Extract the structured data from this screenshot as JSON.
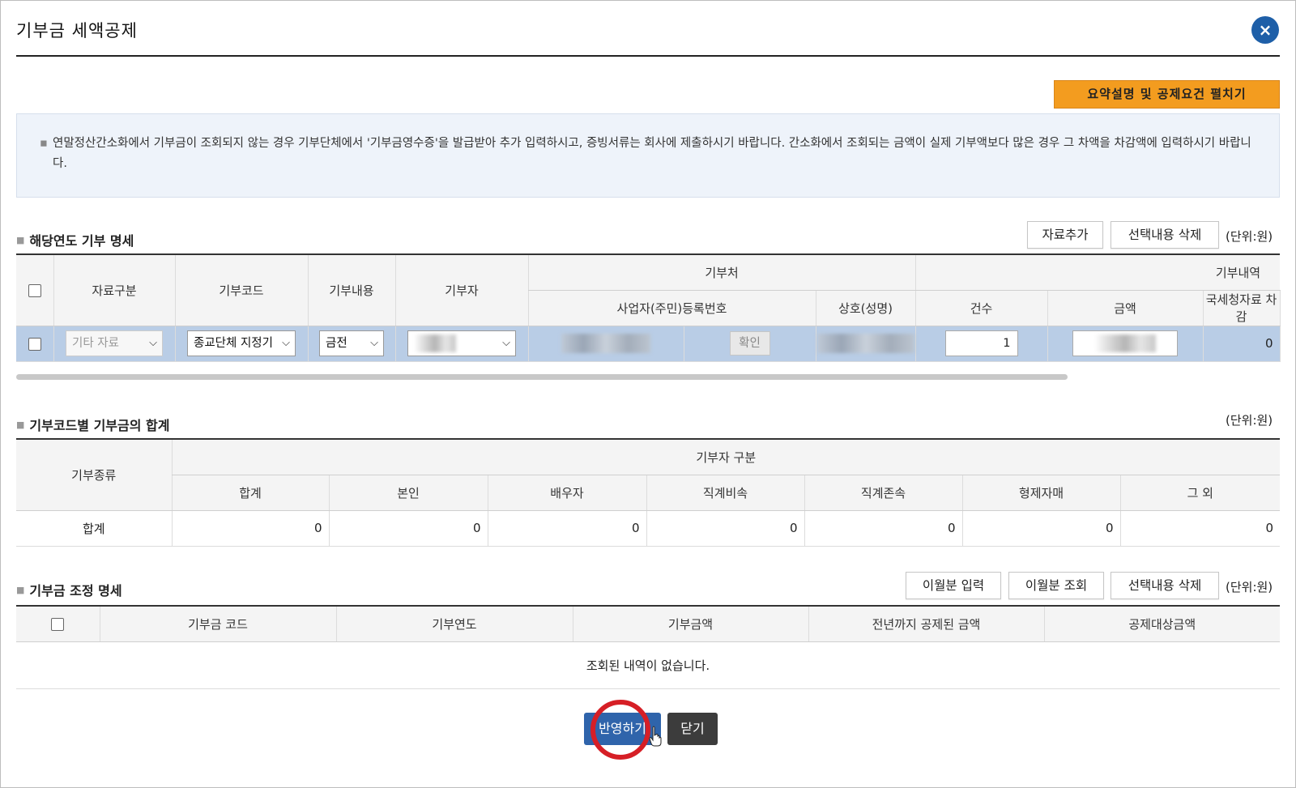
{
  "dialog": {
    "title": "기부금 세액공제",
    "close_label": "×",
    "summary_button": "요약설명 및 공제요건 펼치기",
    "notice": "연말정산간소화에서 기부금이 조회되지 않는 경우 기부단체에서 '기부금영수증'을 발급받아 추가 입력하시고, 증빙서류는 회사에 제출하시기 바랍니다. 간소화에서 조회되는 금액이 실제 기부액보다 많은 경우 그 차액을 차감액에 입력하시기 바랍니다."
  },
  "section1": {
    "title": "해당연도 기부 명세",
    "add_button": "자료추가",
    "delete_button": "선택내용 삭제",
    "unit": "(단위:원)",
    "headers": {
      "data_type": "자료구분",
      "code": "기부코드",
      "content": "기부내용",
      "donor": "기부자",
      "recipient_group": "기부처",
      "reg_no": "사업자(주민)등록번호",
      "name": "상호(성명)",
      "detail_group": "기부내역",
      "count": "건수",
      "amount": "금액",
      "nts_deduct": "국세청자료 차감"
    },
    "row": {
      "data_type": "기타 자료",
      "code": "종교단체 지정기",
      "content": "금전",
      "confirm": "확인",
      "count": "1",
      "nts_deduct": "0"
    }
  },
  "section2": {
    "title": "기부코드별 기부금의 합계",
    "unit": "(단위:원)",
    "headers": {
      "kind": "기부종류",
      "donor_group": "기부자 구분",
      "cols": [
        "합계",
        "본인",
        "배우자",
        "직계비속",
        "직계존속",
        "형제자매",
        "그 외"
      ]
    },
    "row_label": "합계",
    "values": [
      "0",
      "0",
      "0",
      "0",
      "0",
      "0",
      "0"
    ]
  },
  "section3": {
    "title": "기부금 조정 명세",
    "carry_input_button": "이월분 입력",
    "carry_view_button": "이월분 조회",
    "delete_button": "선택내용 삭제",
    "unit": "(단위:원)",
    "headers": [
      "기부금 코드",
      "기부연도",
      "기부금액",
      "전년까지 공제된 금액",
      "공제대상금액"
    ],
    "empty_message": "조회된 내역이 없습니다."
  },
  "footer": {
    "apply_button": "반영하기",
    "close_button": "닫기"
  },
  "colors": {
    "accent": "#2f64ab",
    "summary_button": "#f39c1f",
    "selected_row": "#b9cde6",
    "highlight_circle": "#d61f26"
  }
}
